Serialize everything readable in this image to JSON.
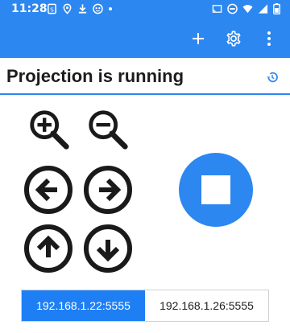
{
  "status_bar": {
    "time": "11:28",
    "left_icons": [
      "sim-card-icon",
      "location-icon",
      "download-icon",
      "game-icon",
      "dot-icon"
    ],
    "right_icons": [
      "cast-icon",
      "do-not-disturb-icon",
      "wifi-icon",
      "signal-icon",
      "battery-icon"
    ]
  },
  "app_bar": {
    "background": "#2d87f0",
    "actions": [
      "add-icon",
      "settings-icon",
      "more-vert-icon"
    ]
  },
  "header": {
    "title": "Projection is running",
    "history_icon": "history-icon"
  },
  "controls": {
    "buttons": [
      "zoom-in",
      "zoom-out",
      "arrow-left",
      "arrow-right",
      "arrow-up",
      "arrow-down"
    ],
    "stop_color": "#2d87f0"
  },
  "addresses": {
    "options": [
      "192.168.1.22:5555",
      "192.168.1.26:5555"
    ],
    "selected_index": 0,
    "selected_color": "#1e7ff5"
  }
}
